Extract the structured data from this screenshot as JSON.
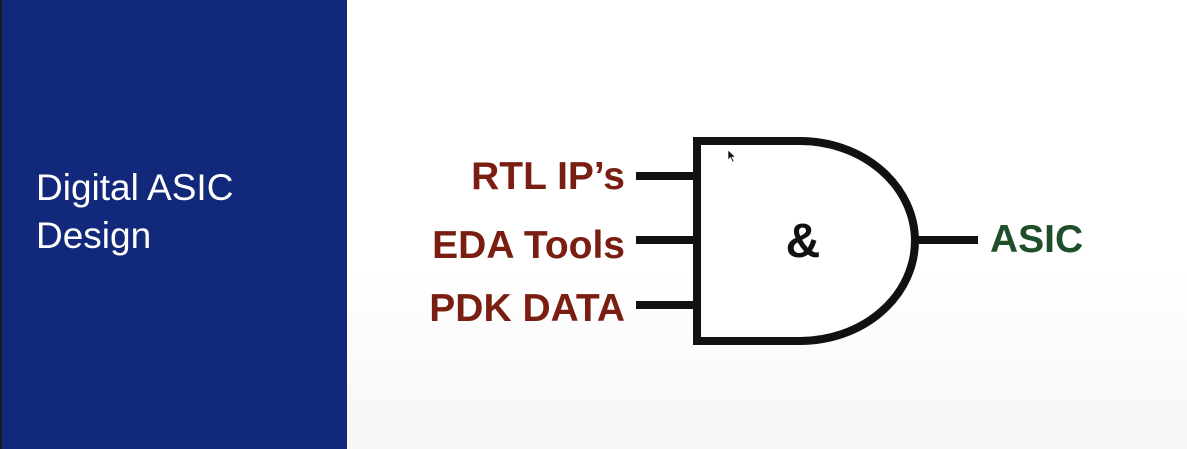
{
  "slide": {
    "title_lines": [
      "Digital ASIC",
      "Design"
    ],
    "colors": {
      "panel": "#12287a",
      "title": "#ffffff",
      "inputs": "#7a1e12",
      "output": "#1e4f2a",
      "gate": "#111111"
    }
  },
  "diagram": {
    "inputs": [
      "RTL IP’s",
      "EDA Tools",
      "PDK DATA"
    ],
    "gate_symbol": "&",
    "output": "ASIC"
  }
}
